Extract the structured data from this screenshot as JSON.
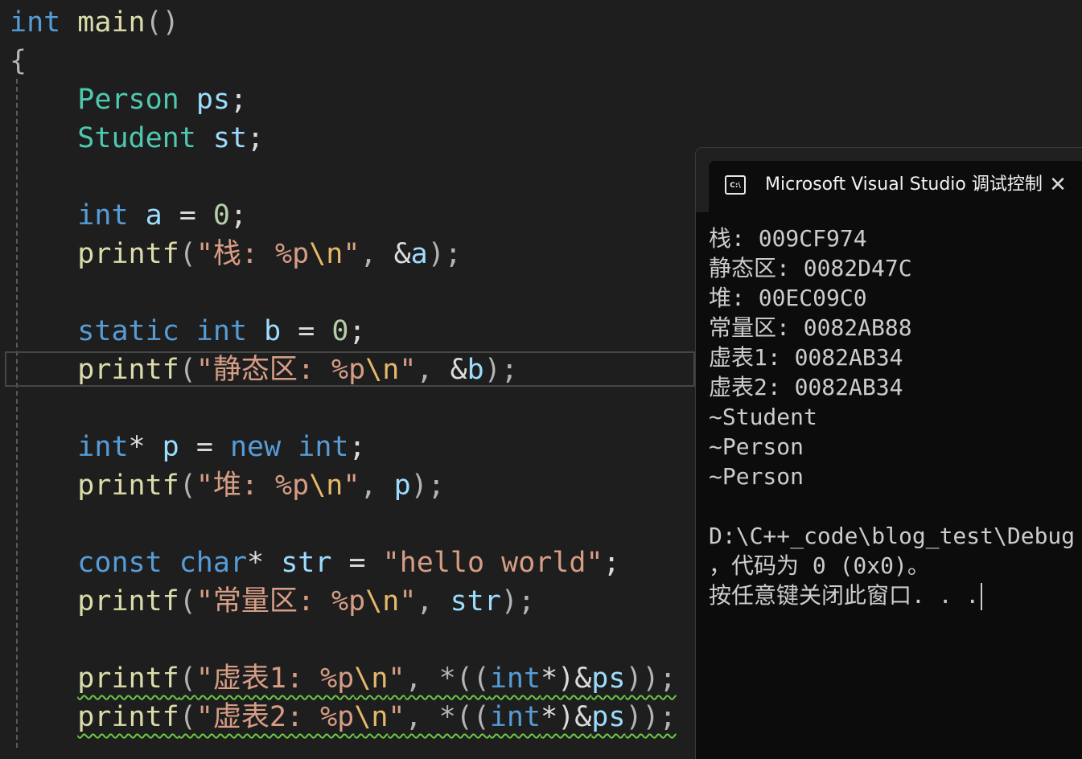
{
  "editor": {
    "l1": {
      "kw": "int",
      "fn": "main",
      "p": "()"
    },
    "l2": {
      "p": "{"
    },
    "l3": {
      "ty": "Person",
      "var": "ps",
      "p": ";"
    },
    "l4": {
      "ty": "Student",
      "var": "st",
      "p": ";"
    },
    "l5": {
      "kw": "int",
      "var": "a",
      "op": " = ",
      "num": "0",
      "p": ";"
    },
    "l6": {
      "fn": "printf",
      "p1": "(",
      "str1": "\"栈: %p",
      "esc": "\\n",
      "str2": "\"",
      "p2": ", ",
      "amp": "&",
      "var": "a",
      "p3": ");"
    },
    "l7": {
      "kw1": "static",
      "kw2": "int",
      "var": "b",
      "op": " = ",
      "num": "0",
      "p": ";"
    },
    "l8": {
      "fn": "printf",
      "p1": "(",
      "str1": "\"静态区: %p",
      "esc": "\\n",
      "str2": "\"",
      "p2": ", ",
      "amp": "&",
      "var": "b",
      "p3": ");"
    },
    "l9": {
      "kw1": "int",
      "op1": "* ",
      "var": "p",
      "op2": " = ",
      "kw2": "new",
      "kw3": "int",
      "p": ";"
    },
    "l10": {
      "fn": "printf",
      "p1": "(",
      "str1": "\"堆: %p",
      "esc": "\\n",
      "str2": "\"",
      "p2": ", ",
      "var": "p",
      "p3": ");"
    },
    "l11": {
      "kw1": "const",
      "kw2": "char",
      "op1": "* ",
      "var": "str",
      "op2": " = ",
      "str": "\"hello world\"",
      "p": ";"
    },
    "l12": {
      "fn": "printf",
      "p1": "(",
      "str1": "\"常量区: %p",
      "esc": "\\n",
      "str2": "\"",
      "p2": ", ",
      "var": "str",
      "p3": ");"
    },
    "l13": {
      "fn": "printf",
      "p1": "(",
      "str1": "\"虚表1: %p",
      "esc": "\\n",
      "str2": "\"",
      "p2": ", *((",
      "kw": "int",
      "p3": "*)&",
      "var": "ps",
      "p4": "));"
    },
    "l14": {
      "fn": "printf",
      "p1": "(",
      "str1": "\"虚表2: %p",
      "esc": "\\n",
      "str2": "\"",
      "p2": ", *((",
      "kw": "int",
      "p3": "*)&",
      "var": "ps",
      "p4": "));"
    }
  },
  "console": {
    "icon_label": "C:\\",
    "title": "Microsoft Visual Studio 调试控制台",
    "close": "✕",
    "lines": [
      "栈: 009CF974",
      "静态区: 0082D47C",
      "堆: 00EC09C0",
      "常量区: 0082AB88",
      "虚表1: 0082AB34",
      "虚表2: 0082AB34",
      "~Student",
      "~Person",
      "~Person",
      "",
      "D:\\C++_code\\blog_test\\Debug",
      "，代码为 0 (0x0)。",
      "按任意键关闭此窗口. . ."
    ]
  },
  "colors": {
    "editor_bg": "#1e1e1e",
    "keyword": "#569cd6",
    "type": "#4ec9b0",
    "function": "#dcdcaa",
    "string": "#d69d85",
    "number": "#b5cea8",
    "variable": "#9cdcfe",
    "console_bg": "#0c0c0c",
    "squiggle": "#6cc644"
  },
  "icons": {
    "console": "console-app-icon",
    "close": "close-icon"
  }
}
